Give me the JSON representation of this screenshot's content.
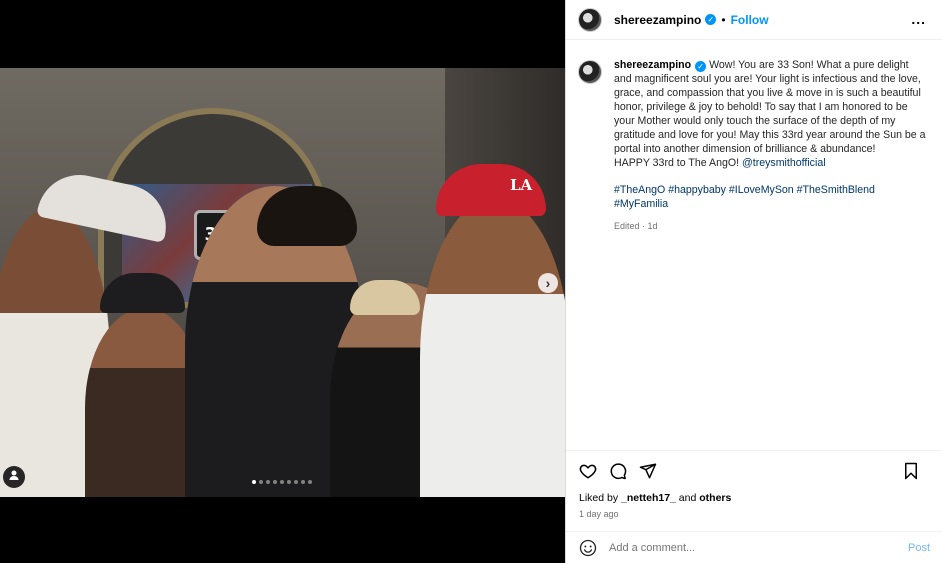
{
  "post": {
    "username": "shereezampino",
    "follow_label": "Follow",
    "bullet": "•",
    "more_label": "...",
    "caption": {
      "username": "shereezampino",
      "text": "Wow! You are 33 Son! What a pure delight and magnificent soul you are! Your light is infectious and the love, grace, and compassion that you live & move in is such a beautiful honor, privilege & joy to behold! To say that I am honored to be your Mother would only touch the surface of the depth of my gratitude and love for you! May this 33rd year around the Sun be a portal into another dimension of brilliance & abundance!",
      "happy_line": "HAPPY 33rd to The AngO! ",
      "mention": "@treysmithofficial",
      "hashtags": [
        "#TheAngO",
        "#happybaby",
        "#ILoveMySon",
        "#TheSmithBlend",
        "#MyFamilia"
      ],
      "edited": "Edited · 1d"
    },
    "likes_prefix": "Liked by ",
    "likes_user": "_netteh17_",
    "likes_suffix": " and ",
    "likes_others": "others",
    "time_ago": "1 day ago",
    "comment_placeholder": "Add a comment...",
    "post_label": "Post",
    "media": {
      "tv_badge_text": "33",
      "cap_logo_text": "LA",
      "next_arrow": "›",
      "carousel_count": 9,
      "carousel_active_index": 0
    }
  },
  "colors": {
    "accent": "#0095f6",
    "link": "#00376b",
    "muted": "#737373",
    "post_disabled": "#73b7f3"
  }
}
